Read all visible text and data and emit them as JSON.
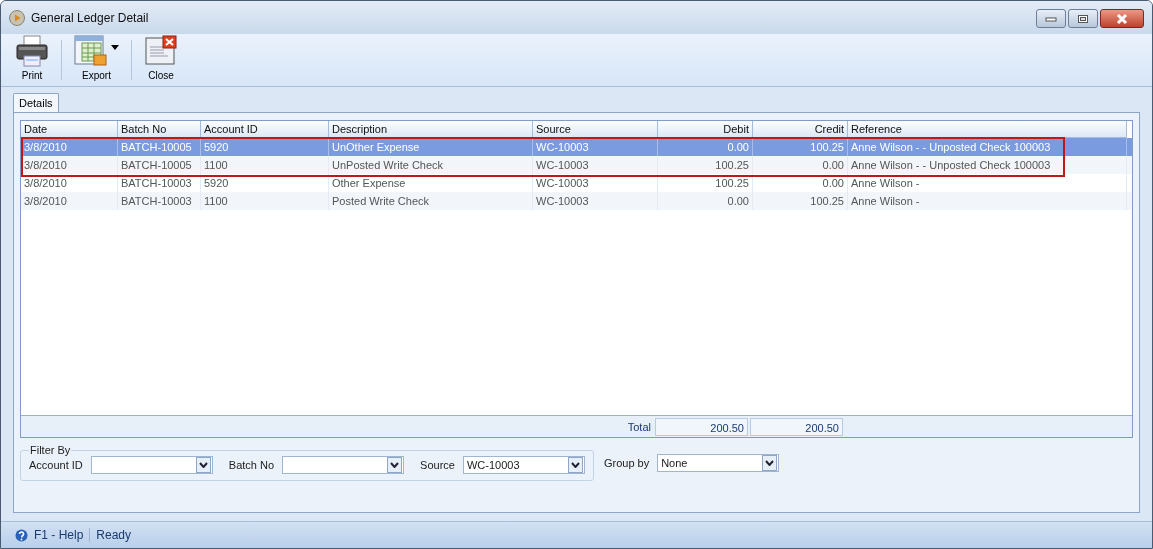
{
  "window": {
    "title": "General Ledger Detail"
  },
  "toolbar": [
    {
      "label": "Print",
      "kind": "print"
    },
    {
      "label": "Export",
      "kind": "export"
    },
    {
      "label": "Close",
      "kind": "close"
    }
  ],
  "tabs": [
    {
      "label": "Details",
      "selected": true
    }
  ],
  "table": {
    "columns": [
      {
        "label": "Date",
        "kind": "text"
      },
      {
        "label": "Batch No",
        "kind": "text"
      },
      {
        "label": "Account ID",
        "kind": "text"
      },
      {
        "label": "Description",
        "kind": "text"
      },
      {
        "label": "Source",
        "kind": "text"
      },
      {
        "label": "Debit",
        "kind": "amount"
      },
      {
        "label": "Credit",
        "kind": "amount"
      },
      {
        "label": "Reference",
        "kind": "text"
      }
    ],
    "rows": [
      {
        "cells": [
          "3/8/2010",
          "BATCH-10005",
          "5920",
          "UnOther Expense",
          "WC-10003",
          "0.00",
          "100.25",
          "Anne Wilson - - Unposted Check 100003"
        ],
        "selected": true,
        "highlighted": true
      },
      {
        "cells": [
          "3/8/2010",
          "BATCH-10005",
          "1100",
          "UnPosted Write Check",
          "WC-10003",
          "100.25",
          "0.00",
          "Anne Wilson - - Unposted Check 100003"
        ],
        "selected": false,
        "highlighted": true
      },
      {
        "cells": [
          "3/8/2010",
          "BATCH-10003",
          "5920",
          "Other Expense",
          "WC-10003",
          "100.25",
          "0.00",
          "Anne Wilson -"
        ],
        "selected": false,
        "highlighted": false
      },
      {
        "cells": [
          "3/8/2010",
          "BATCH-10003",
          "1100",
          "Posted Write Check",
          "WC-10003",
          "0.00",
          "100.25",
          "Anne Wilson -"
        ],
        "selected": false,
        "highlighted": false
      }
    ],
    "totals": {
      "label": "Total",
      "debit": "200.50",
      "credit": "200.50"
    }
  },
  "filter": {
    "title": "Filter By",
    "fields": [
      {
        "label": "Account ID"
      },
      {
        "label": "Batch No"
      },
      {
        "label": "Source",
        "value": "WC-10003"
      }
    ]
  },
  "group_by": {
    "label": "Group by",
    "value": "None"
  },
  "status_bar": {
    "help": "F1 - Help",
    "status": "Ready"
  }
}
